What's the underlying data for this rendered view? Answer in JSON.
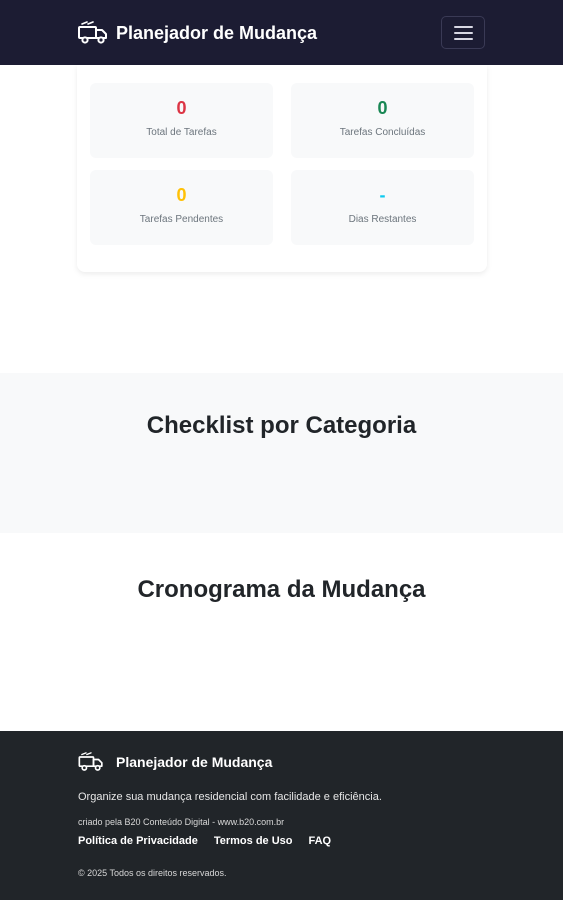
{
  "header": {
    "brand": "Planejador de Mudança",
    "menu_icon": "hamburger-menu-icon",
    "brand_icon": "moving-truck-icon"
  },
  "stats": [
    {
      "value": "0",
      "label": "Total de Tarefas",
      "color": "#dc3545"
    },
    {
      "value": "0",
      "label": "Tarefas Concluídas",
      "color": "#198754"
    },
    {
      "value": "0",
      "label": "Tarefas Pendentes",
      "color": "#ffc107"
    },
    {
      "value": "-",
      "label": "Dias Restantes",
      "color": "#0dcaf0"
    }
  ],
  "sections": {
    "checklist_title": "Checklist por Categoria",
    "timeline_title": "Cronograma da Mudança"
  },
  "footer": {
    "brand": "Planejador de Mudança",
    "description": "Organize sua mudança residencial com facilidade e eficiência.",
    "credit": "criado pela B20 Conteúdo Digital - www.b20.com.br",
    "links": [
      "Política de Privacidade",
      "Termos de Uso",
      "FAQ"
    ],
    "copyright": "© 2025 Todos os direitos reservados."
  }
}
